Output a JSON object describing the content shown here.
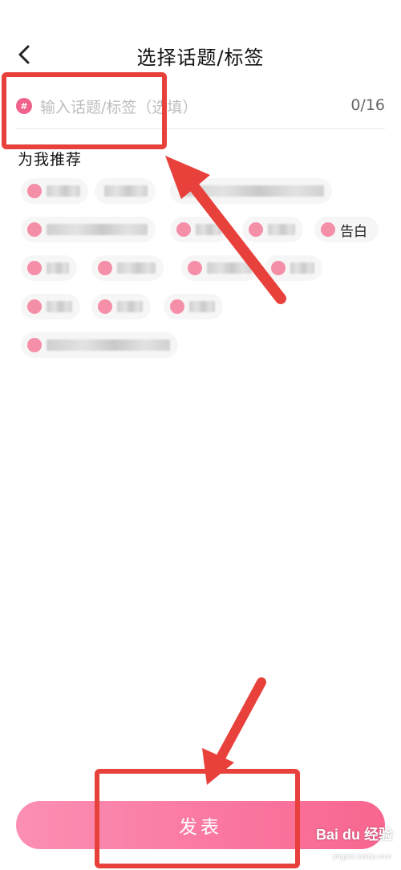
{
  "header": {
    "title": "选择话题/标签",
    "back_icon": "chevron-left-icon"
  },
  "input": {
    "placeholder": "输入话题/标签（选填）",
    "value": "",
    "counter": "0/16",
    "hash_icon_text": "#"
  },
  "recommend": {
    "title": "为我推荐",
    "chips": [
      {
        "label": ""
      },
      {
        "label": ""
      },
      {
        "label": ""
      },
      {
        "label": ""
      },
      {
        "label": ""
      },
      {
        "label": ""
      },
      {
        "label": "告白"
      },
      {
        "label": ""
      },
      {
        "label": ""
      },
      {
        "label": ""
      },
      {
        "label": ""
      },
      {
        "label": ""
      },
      {
        "label": ""
      },
      {
        "label": ""
      },
      {
        "label": ""
      }
    ]
  },
  "publish_button": {
    "label": "发表"
  },
  "watermark": {
    "text": "Bai du 经验",
    "sub": "jingyan.baidu.com"
  },
  "colors": {
    "accent": "#f8668f",
    "annotation": "#e8403a",
    "chip_bg": "#f6f6f6"
  }
}
